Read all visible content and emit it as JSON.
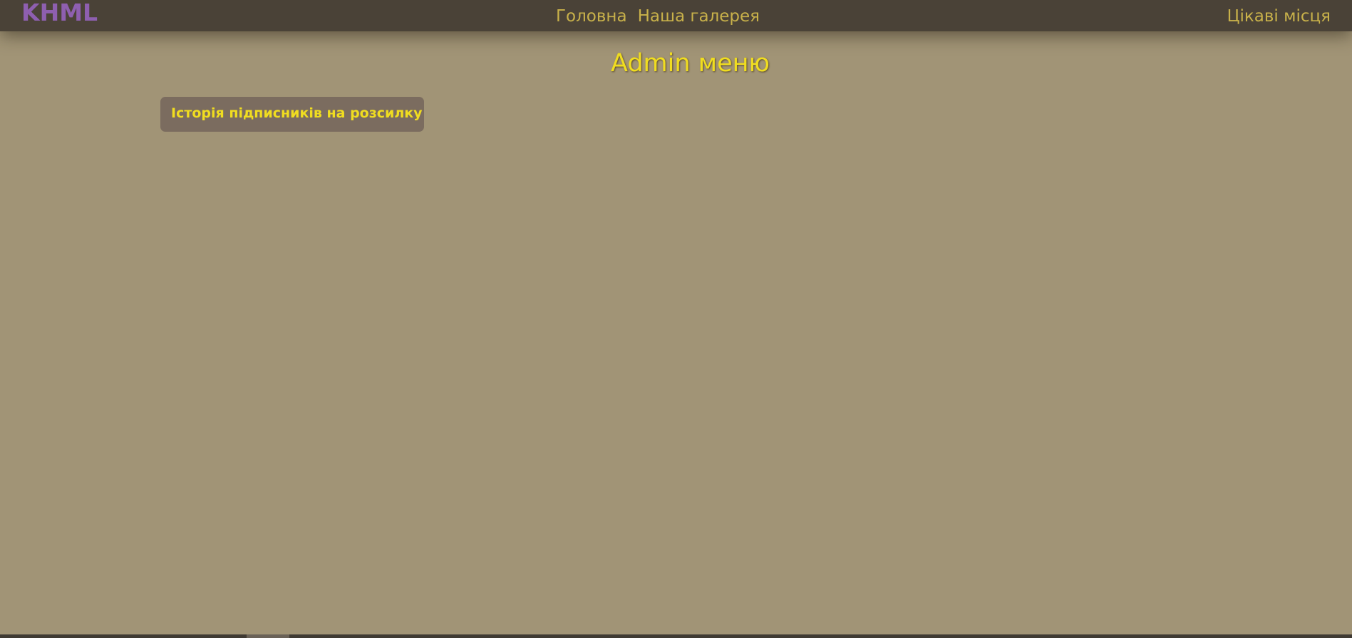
{
  "navbar": {
    "logo": "KHML",
    "links": [
      {
        "label": "Головна"
      },
      {
        "label": "Наша галерея"
      }
    ],
    "right_link": "Цікаві місця"
  },
  "main": {
    "title": "Admin меню",
    "buttons": [
      {
        "label": "Історія підписників на розсилку"
      }
    ]
  },
  "colors": {
    "background": "#a19476",
    "navbar": "#4a4237",
    "logo": "#8e5fb0",
    "nav_link": "#c8b14a",
    "title": "#f0dd20",
    "button_bg": "#7b6c5f"
  }
}
